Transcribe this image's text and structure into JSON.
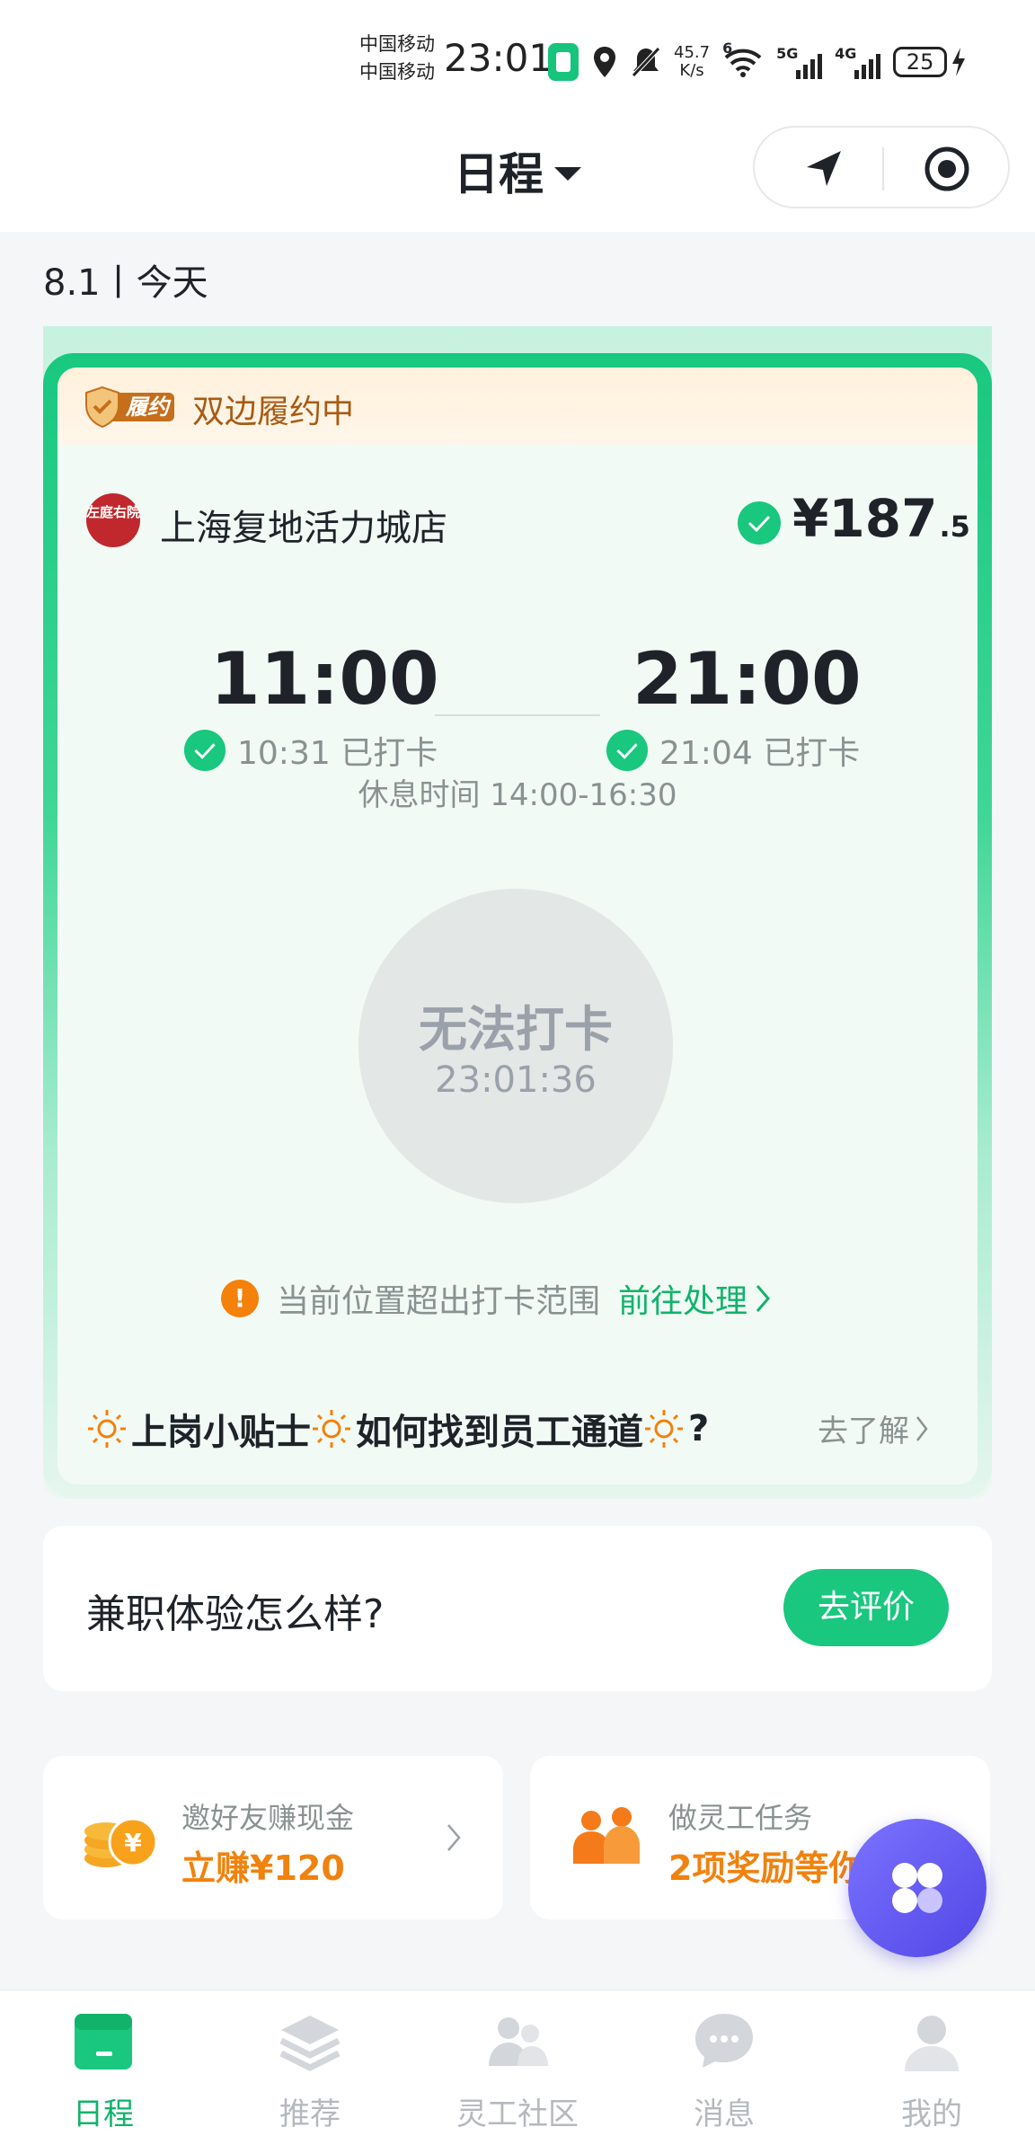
{
  "status_bar": {
    "carrier_1": "中国移动",
    "carrier_2": "中国移动",
    "time": "23:01",
    "net_speed_value": "45.7",
    "net_speed_unit": "K/s",
    "wifi_tag": "6",
    "sim1_tag": "5G",
    "sim2_tag": "4G",
    "battery": "25"
  },
  "header": {
    "title": "日程"
  },
  "date_label": "8.1丨今天",
  "shift_card": {
    "status_text": "双边履约中",
    "status_badge_text": "履约",
    "store_logo_text": "左庭右院",
    "store_name": "上海复地活力城店",
    "price_main": "¥187",
    "price_decimal": ".5",
    "start_time": "11:00",
    "end_time": "21:00",
    "start_punch": "10:31 已打卡",
    "end_punch": "21:04 已打卡",
    "rest_time": "休息时间 14:00-16:30",
    "punch_button_label": "无法打卡",
    "punch_button_clock": "23:01:36",
    "warning_text": "当前位置超出打卡范围",
    "warning_link": "前往处理",
    "tips_title_1": "上岗小贴士",
    "tips_title_2": "如何找到员工通道",
    "tips_title_3": "?",
    "tips_more": "去了解"
  },
  "review": {
    "question": "兼职体验怎么样?",
    "button": "去评价"
  },
  "promos": [
    {
      "subtitle": "邀好友赚现金",
      "main": "立赚¥120",
      "icon": "coins-icon"
    },
    {
      "subtitle": "做灵工任务",
      "main": "2项奖励等你",
      "icon": "people-icon"
    }
  ],
  "tabs": [
    {
      "label": "日程",
      "icon": "calendar-icon",
      "active": true
    },
    {
      "label": "推荐",
      "icon": "layers-icon",
      "active": false
    },
    {
      "label": "灵工社区",
      "icon": "community-icon",
      "active": false
    },
    {
      "label": "消息",
      "icon": "message-icon",
      "active": false
    },
    {
      "label": "我的",
      "icon": "profile-icon",
      "active": false
    }
  ],
  "colors": {
    "brand_green": "#19c77f",
    "warning_orange": "#f5800a",
    "promo_orange": "#f0820f",
    "fab_purple": "#5f56f0",
    "fulfill_brown": "#a85b14"
  }
}
